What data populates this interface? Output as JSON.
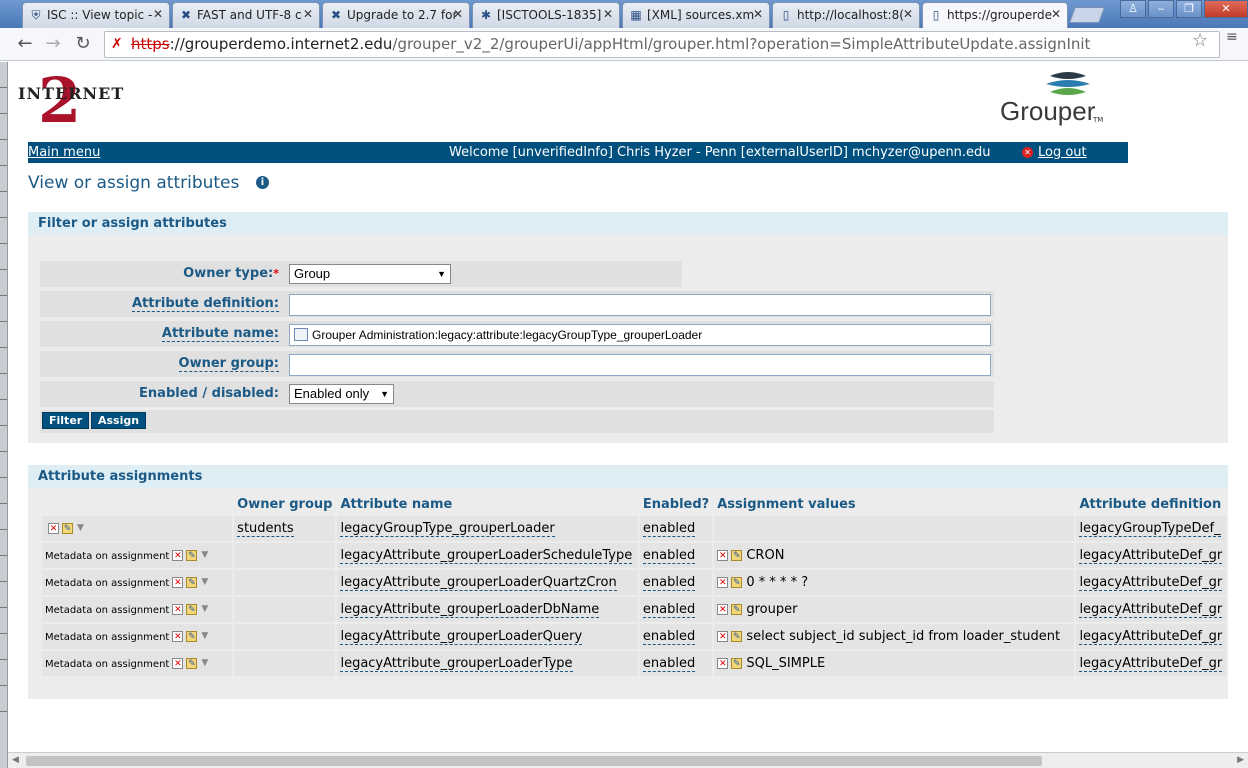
{
  "browser": {
    "tabs": [
      {
        "title": "ISC :: View topic -",
        "icon": "penn-shield-icon"
      },
      {
        "title": "FAST and UTF-8 c",
        "icon": "atlassian-icon"
      },
      {
        "title": "Upgrade to 2.7 for",
        "icon": "atlassian-icon"
      },
      {
        "title": "[ISCTOOLS-1835]",
        "icon": "jira-icon"
      },
      {
        "title": "[XML] sources.xm",
        "icon": "xml-icon"
      },
      {
        "title": "http://localhost:8(",
        "icon": "page-icon"
      },
      {
        "title": "https://grouperde",
        "icon": "page-icon"
      }
    ],
    "url_scheme": "https",
    "url_host": "://grouperdemo.internet2.edu",
    "url_path": "/grouper_v2_2/grouperUi/appHtml/grouper.html?operation=SimpleAttributeUpdate.assignInit"
  },
  "header": {
    "logo_left": "INTERNET",
    "logo_left_mark": "2",
    "logo_right": "Grouper",
    "logo_right_tm": "TM",
    "main_menu": "Main menu",
    "welcome": "Welcome [unverifiedInfo] Chris Hyzer - Penn [externalUserID] mchyzer@upenn.edu",
    "logout": "Log out"
  },
  "page": {
    "title": "View or assign attributes",
    "info": "i"
  },
  "filter": {
    "heading": "Filter or assign attributes",
    "owner_type_label": "Owner type:",
    "owner_type_value": "Group",
    "attr_def_label": "Attribute definition:",
    "attr_def_value": "",
    "attr_name_label": "Attribute name:",
    "attr_name_value": "Grouper Administration:legacy:attribute:legacyGroupType_grouperLoader",
    "owner_group_label": "Owner group:",
    "owner_group_value": "",
    "enabled_label": "Enabled / disabled:",
    "enabled_value": "Enabled only",
    "filter_button": "Filter",
    "assign_button": "Assign"
  },
  "assignments": {
    "heading": "Attribute assignments",
    "columns": [
      "Owner group",
      "Attribute name",
      "Enabled?",
      "Assignment values",
      "Attribute definition"
    ],
    "rows": [
      {
        "meta": "",
        "owner": "students",
        "name": "legacyGroupType_grouperLoader",
        "enabled": "enabled",
        "value": "",
        "def": "legacyGroupTypeDef_"
      },
      {
        "meta": "Metadata on assignment",
        "owner": "",
        "name": "legacyAttribute_grouperLoaderScheduleType",
        "enabled": "enabled",
        "value": "CRON",
        "def": "legacyAttributeDef_gr"
      },
      {
        "meta": "Metadata on assignment",
        "owner": "",
        "name": "legacyAttribute_grouperLoaderQuartzCron",
        "enabled": "enabled",
        "value": "0 * * * * ?",
        "def": "legacyAttributeDef_gr"
      },
      {
        "meta": "Metadata on assignment",
        "owner": "",
        "name": "legacyAttribute_grouperLoaderDbName",
        "enabled": "enabled",
        "value": "grouper",
        "def": "legacyAttributeDef_gr"
      },
      {
        "meta": "Metadata on assignment",
        "owner": "",
        "name": "legacyAttribute_grouperLoaderQuery",
        "enabled": "enabled",
        "value": "select subject_id subject_id from loader_student",
        "def": "legacyAttributeDef_gr"
      },
      {
        "meta": "Metadata on assignment",
        "owner": "",
        "name": "legacyAttribute_grouperLoaderType",
        "enabled": "enabled",
        "value": "SQL_SIMPLE",
        "def": "legacyAttributeDef_gr"
      }
    ]
  }
}
